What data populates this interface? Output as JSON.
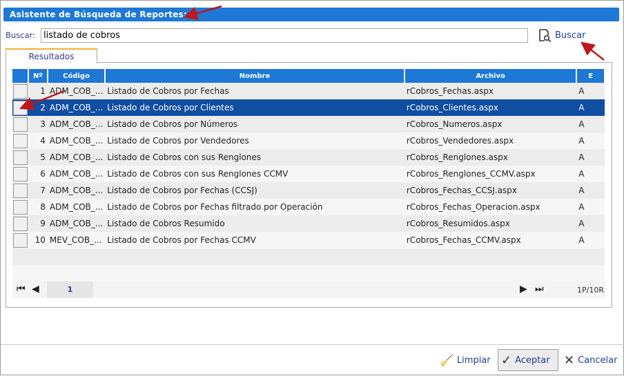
{
  "title": "Asistente de Búsqueda de Reportes:",
  "search": {
    "label": "Buscar:",
    "value": "listado de cobros",
    "button": "Buscar"
  },
  "tab": "Resultados",
  "columns": {
    "no": "Nº",
    "codigo": "Código",
    "nombre": "Nombre",
    "archivo": "Archivo",
    "e": "E"
  },
  "rows": [
    {
      "no": "1",
      "codigo": "ADM_COB_...",
      "nombre": "Listado de Cobros por Fechas",
      "archivo": "rCobros_Fechas.aspx",
      "e": "A"
    },
    {
      "no": "2",
      "codigo": "ADM_COB_...",
      "nombre": "Listado de Cobros por Clientes",
      "archivo": "rCobros_Clientes.aspx",
      "e": "A",
      "selected": true
    },
    {
      "no": "3",
      "codigo": "ADM_COB_...",
      "nombre": "Listado de Cobros por Números",
      "archivo": "rCobros_Numeros.aspx",
      "e": "A"
    },
    {
      "no": "4",
      "codigo": "ADM_COB_...",
      "nombre": "Listado de Cobros por Vendedores",
      "archivo": "rCobros_Vendedores.aspx",
      "e": "A"
    },
    {
      "no": "5",
      "codigo": "ADM_COB_...",
      "nombre": "Listado de Cobros con sus Renglones",
      "archivo": "rCobros_Renglones.aspx",
      "e": "A"
    },
    {
      "no": "6",
      "codigo": "ADM_COB_...",
      "nombre": "Listado de Cobros con sus Renglones CCMV",
      "archivo": "rCobros_Renglones_CCMV.aspx",
      "e": "A"
    },
    {
      "no": "7",
      "codigo": "ADM_COB_...",
      "nombre": "Listado de Cobros por Fechas (CCSJ)",
      "archivo": "rCobros_Fechas_CCSJ.aspx",
      "e": "A"
    },
    {
      "no": "8",
      "codigo": "ADM_COB_...",
      "nombre": "Listado de Cobros por Fechas filtrado por Operación",
      "archivo": "rCobros_Fechas_Operacion.aspx",
      "e": "A"
    },
    {
      "no": "9",
      "codigo": "ADM_COB_...",
      "nombre": "Listado de Cobros Resumido",
      "archivo": "rCobros_Resumidos.aspx",
      "e": "A"
    },
    {
      "no": "10",
      "codigo": "MEV_COB_...",
      "nombre": "Listado de Cobros por Fechas CCMV",
      "archivo": "rCobros_Fechas_CCMV.aspx",
      "e": "A"
    }
  ],
  "pager": {
    "page": "1",
    "info": "1P/10R"
  },
  "buttons": {
    "clear": "Limpiar",
    "accept": "Aceptar",
    "cancel": "Cancelar"
  },
  "colors": {
    "header": "#1d78d6",
    "selected": "#0f4ea0",
    "annotation": "#c01818"
  }
}
